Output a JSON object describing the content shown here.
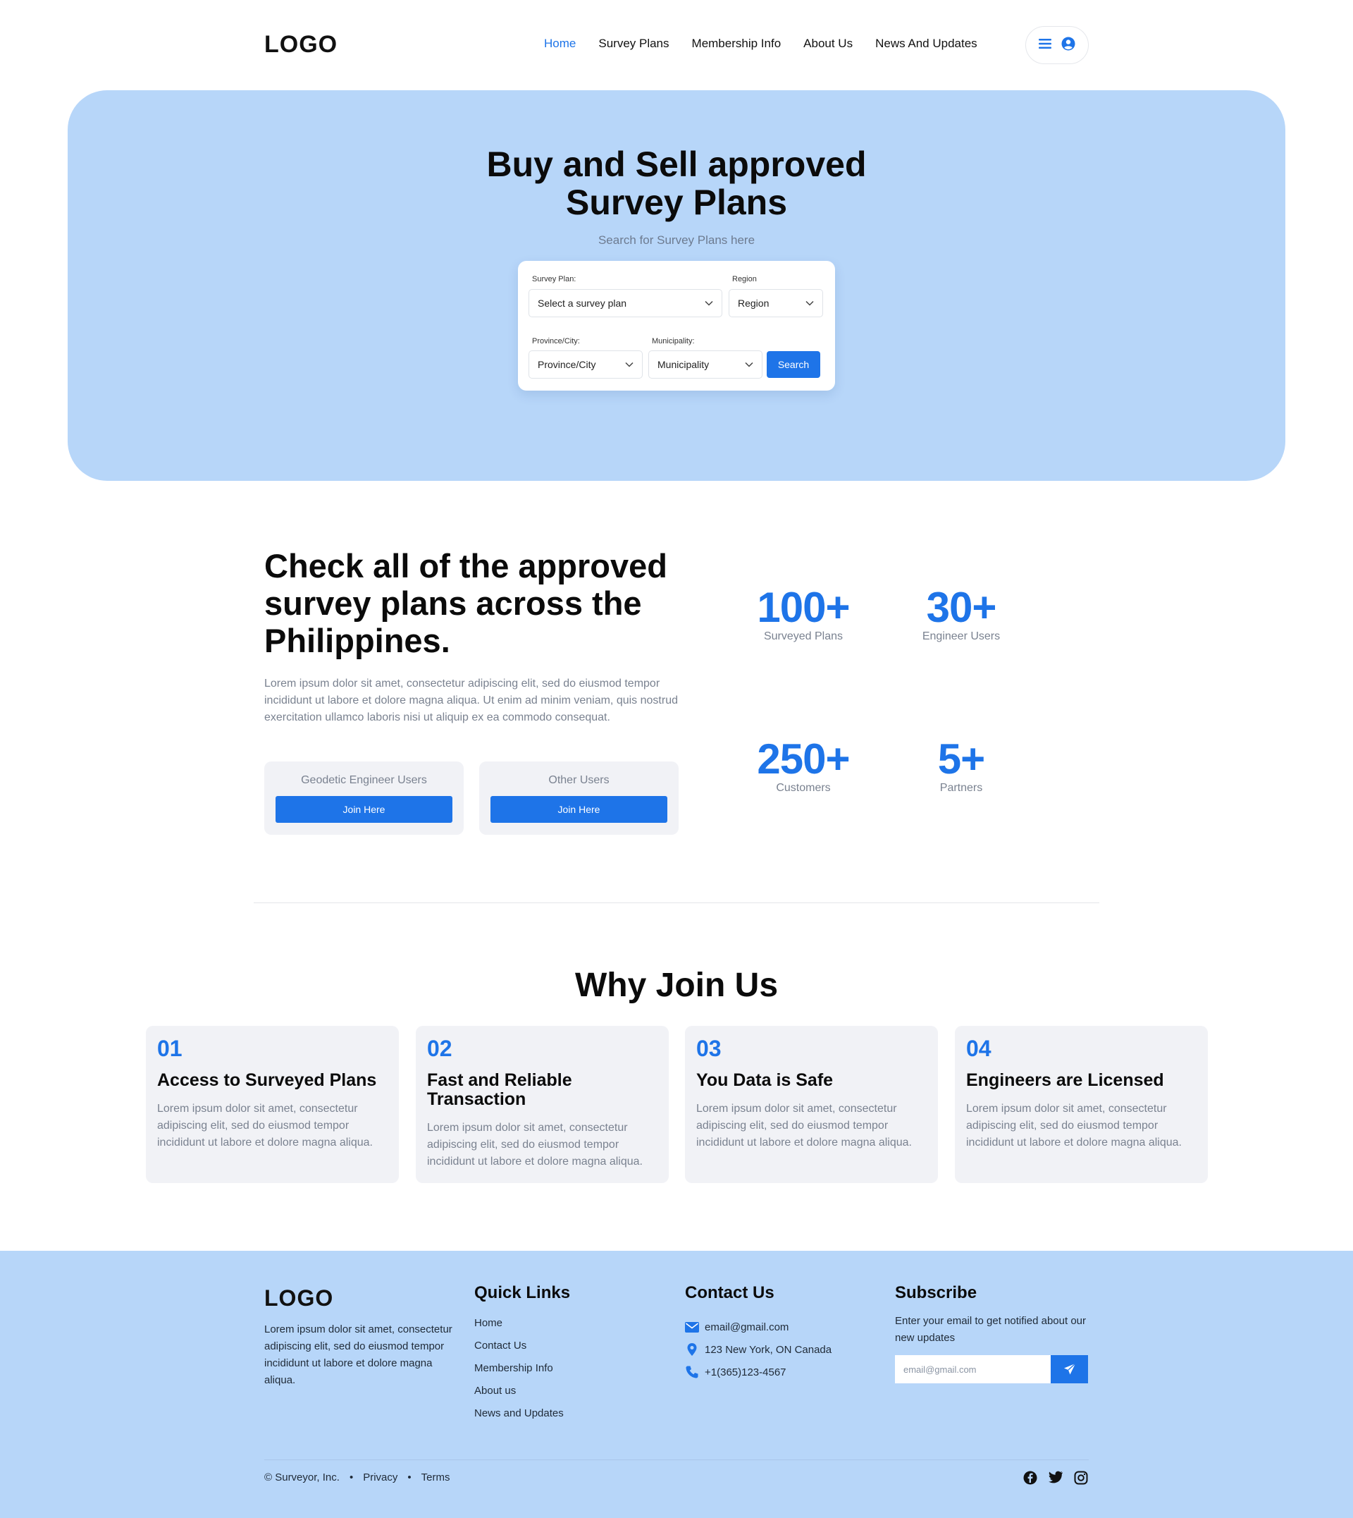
{
  "nav": {
    "logo": "LOGO",
    "links": [
      "Home",
      "Survey Plans",
      "Membership Info",
      "About Us",
      "News And Updates"
    ],
    "active": "Home",
    "icons": [
      "menu-icon",
      "user-icon"
    ]
  },
  "hero": {
    "title_line1": "Buy and Sell approved",
    "title_line2": "Survey Plans",
    "subtitle": "Search for Survey Plans here",
    "search": {
      "survey_plan_label": "Survey Plan:",
      "survey_plan_value": "Select a survey plan",
      "region_label": "Region",
      "region_value": "Region",
      "province_label": "Province/City:",
      "province_value": "Province/City",
      "municipality_label": "Municipality:",
      "municipality_value": "Municipality",
      "button": "Search"
    }
  },
  "check": {
    "title": "Check all of the approved survey plans across the Philippines.",
    "text": "Lorem ipsum dolor sit amet, consectetur adipiscing elit, sed do eiusmod tempor incididunt ut labore et dolore magna aliqua. Ut enim ad minim veniam, quis nostrud exercitation ullamco laboris nisi ut aliquip ex ea commodo consequat.",
    "join_boxes": [
      {
        "label": "Geodetic Engineer Users",
        "button": "Join Here"
      },
      {
        "label": "Other Users",
        "button": "Join Here"
      }
    ],
    "stats": [
      {
        "num": "100+",
        "label": "Surveyed Plans"
      },
      {
        "num": "30+",
        "label": "Engineer Users"
      },
      {
        "num": "250+",
        "label": "Customers"
      },
      {
        "num": "5+",
        "label": "Partners"
      }
    ]
  },
  "why": {
    "title": "Why Join Us",
    "cards": [
      {
        "num": "01",
        "title": "Access to Surveyed Plans",
        "text": "Lorem ipsum dolor sit amet, consectetur adipiscing elit, sed do eiusmod tempor incididunt ut labore et dolore magna aliqua."
      },
      {
        "num": "02",
        "title": "Fast and Reliable Transaction",
        "text": "Lorem ipsum dolor sit amet, consectetur adipiscing elit, sed do eiusmod tempor incididunt ut labore et dolore magna aliqua."
      },
      {
        "num": "03",
        "title": "You Data is Safe",
        "text": "Lorem ipsum dolor sit amet, consectetur adipiscing elit, sed do eiusmod tempor incididunt ut labore et dolore magna aliqua."
      },
      {
        "num": "04",
        "title": "Engineers are Licensed",
        "text": "Lorem ipsum dolor sit amet, consectetur adipiscing elit, sed do eiusmod tempor incididunt ut labore et dolore magna aliqua."
      }
    ]
  },
  "footer": {
    "logo": "LOGO",
    "about": "Lorem ipsum dolor sit amet, consectetur adipiscing elit, sed do eiusmod tempor incididunt ut labore et dolore magna aliqua.",
    "quick_links_title": "Quick Links",
    "quick_links": [
      "Home",
      "Contact Us",
      "Membership Info",
      "About us",
      "News and Updates"
    ],
    "contact_title": "Contact Us",
    "contact": {
      "email": "email@gmail.com",
      "address": "123 New York, ON Canada",
      "phone": "+1(365)123-4567"
    },
    "subscribe_title": "Subscribe",
    "subscribe_text": "Enter your email to get notified about our new updates",
    "subscribe_placeholder": "email@gmail.com",
    "copyright": "© Surveyor, Inc.",
    "bottom_links": [
      "Privacy",
      "Terms"
    ],
    "social": [
      "facebook-icon",
      "twitter-icon",
      "instagram-icon"
    ]
  },
  "colors": {
    "accent": "#1e74e8",
    "hero_bg": "#b7d6f9",
    "card_bg": "#f1f2f6",
    "muted_text": "#7a8290"
  }
}
